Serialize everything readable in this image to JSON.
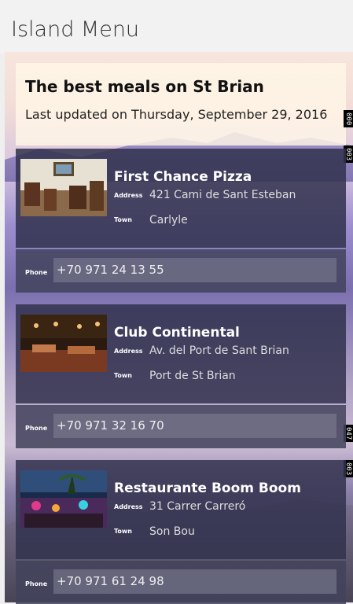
{
  "app": {
    "title": "Island Menu"
  },
  "header": {
    "headline": "The best meals on St Brian",
    "updated": "Last updated on Thursday, September 29, 2016"
  },
  "labels": {
    "address": "Address",
    "town": "Town",
    "phone": "Phone"
  },
  "side_tags": [
    "000",
    "003",
    "047",
    "003"
  ],
  "restaurants": [
    {
      "name": "First Chance Pizza",
      "address": "421 Cami de Sant Esteban",
      "town": "Carlyle",
      "phone": "+70 971 24 13 55"
    },
    {
      "name": "Club Continental",
      "address": "Av. del Port de Sant Brian",
      "town": "Port de St Brian",
      "phone": "+70 971 32 16 70"
    },
    {
      "name": "Restaurante Boom Boom",
      "address": "31 Carrer Carreró",
      "town": "Son Bou",
      "phone": "+70 971 61 24 98"
    }
  ]
}
